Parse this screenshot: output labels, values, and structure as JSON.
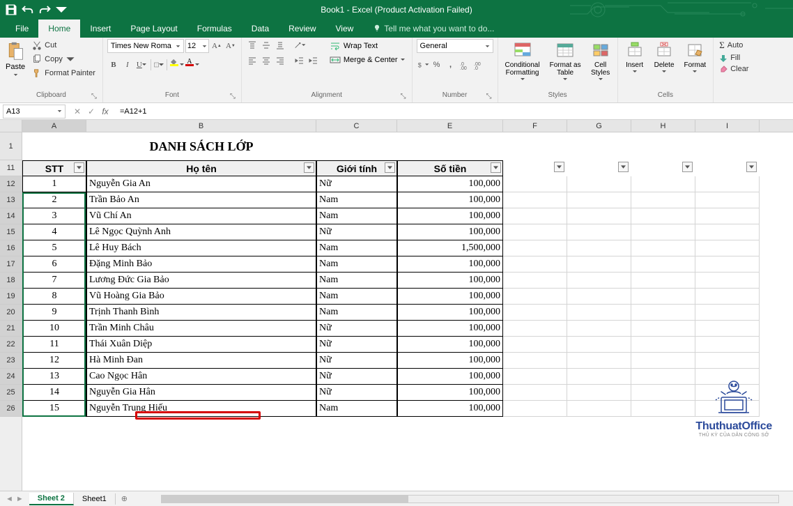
{
  "titlebar": {
    "title": "Book1 - Excel (Product Activation Failed)"
  },
  "tabs": {
    "file": "File",
    "home": "Home",
    "insert": "Insert",
    "pagelayout": "Page Layout",
    "formulas": "Formulas",
    "data": "Data",
    "review": "Review",
    "view": "View",
    "tellme": "Tell me what you want to do..."
  },
  "ribbon": {
    "clipboard": {
      "paste": "Paste",
      "cut": "Cut",
      "copy": "Copy",
      "painter": "Format Painter",
      "label": "Clipboard"
    },
    "font": {
      "name": "Times New Roma",
      "size": "12",
      "label": "Font"
    },
    "alignment": {
      "wrap": "Wrap Text",
      "merge": "Merge & Center",
      "label": "Alignment"
    },
    "number": {
      "format": "General",
      "label": "Number"
    },
    "styles": {
      "cond": "Conditional\nFormatting",
      "table": "Format as\nTable",
      "cell": "Cell\nStyles",
      "label": "Styles"
    },
    "cells": {
      "insert": "Insert",
      "delete": "Delete",
      "format": "Format",
      "label": "Cells"
    },
    "editing": {
      "autosum": "Auto",
      "fill": "Fill",
      "clear": "Clear"
    }
  },
  "formula": {
    "namebox": "A13",
    "formula": "=A12+1"
  },
  "columns": [
    "A",
    "B",
    "C",
    "E",
    "F",
    "G",
    "H",
    "I"
  ],
  "rowNums": [
    "1",
    "11",
    "12",
    "13",
    "14",
    "15",
    "16",
    "17",
    "18",
    "19",
    "20",
    "21",
    "22",
    "23",
    "24",
    "25",
    "26"
  ],
  "table": {
    "title": "DANH SÁCH LỚP",
    "headers": {
      "stt": "STT",
      "name": "Họ tên",
      "gender": "Giới tính",
      "amount": "Số tiền"
    },
    "rows": [
      {
        "stt": "1",
        "name": "Nguyễn Gia An",
        "gender": "Nữ",
        "amount": "100,000"
      },
      {
        "stt": "2",
        "name": "Trần Bảo An",
        "gender": "Nam",
        "amount": "100,000"
      },
      {
        "stt": "3",
        "name": "Vũ Chí An",
        "gender": "Nam",
        "amount": "100,000"
      },
      {
        "stt": "4",
        "name": "Lê Ngọc Quỳnh Anh",
        "gender": "Nữ",
        "amount": "100,000"
      },
      {
        "stt": "5",
        "name": "Lê Huy Bách",
        "gender": "Nam",
        "amount": "1,500,000"
      },
      {
        "stt": "6",
        "name": "Đặng Minh Bảo",
        "gender": "Nam",
        "amount": "100,000"
      },
      {
        "stt": "7",
        "name": "Lương Đức Gia Bảo",
        "gender": "Nam",
        "amount": "100,000"
      },
      {
        "stt": "8",
        "name": "Vũ Hoàng Gia Bảo",
        "gender": "Nam",
        "amount": "100,000"
      },
      {
        "stt": "9",
        "name": "Trịnh Thanh Bình",
        "gender": "Nam",
        "amount": "100,000"
      },
      {
        "stt": "10",
        "name": "Trần Minh Châu",
        "gender": "Nữ",
        "amount": "100,000"
      },
      {
        "stt": "11",
        "name": "Thái Xuân Diệp",
        "gender": "Nữ",
        "amount": "100,000"
      },
      {
        "stt": "12",
        "name": "Hà Minh Đan",
        "gender": "Nữ",
        "amount": "100,000"
      },
      {
        "stt": "13",
        "name": "Cao Ngọc Hân",
        "gender": "Nữ",
        "amount": "100,000"
      },
      {
        "stt": "14",
        "name": "Nguyễn Gia Hân",
        "gender": "Nữ",
        "amount": "100,000"
      },
      {
        "stt": "15",
        "name": "Nguyễn Trung Hiếu",
        "gender": "Nam",
        "amount": "100,000"
      }
    ]
  },
  "sheets": {
    "s2": "Sheet 2",
    "s1": "Sheet1"
  },
  "watermark": {
    "name": "ThuthuatOffice",
    "tag": "THỦ KỲ CỦA DÂN CÔNG SỞ"
  }
}
